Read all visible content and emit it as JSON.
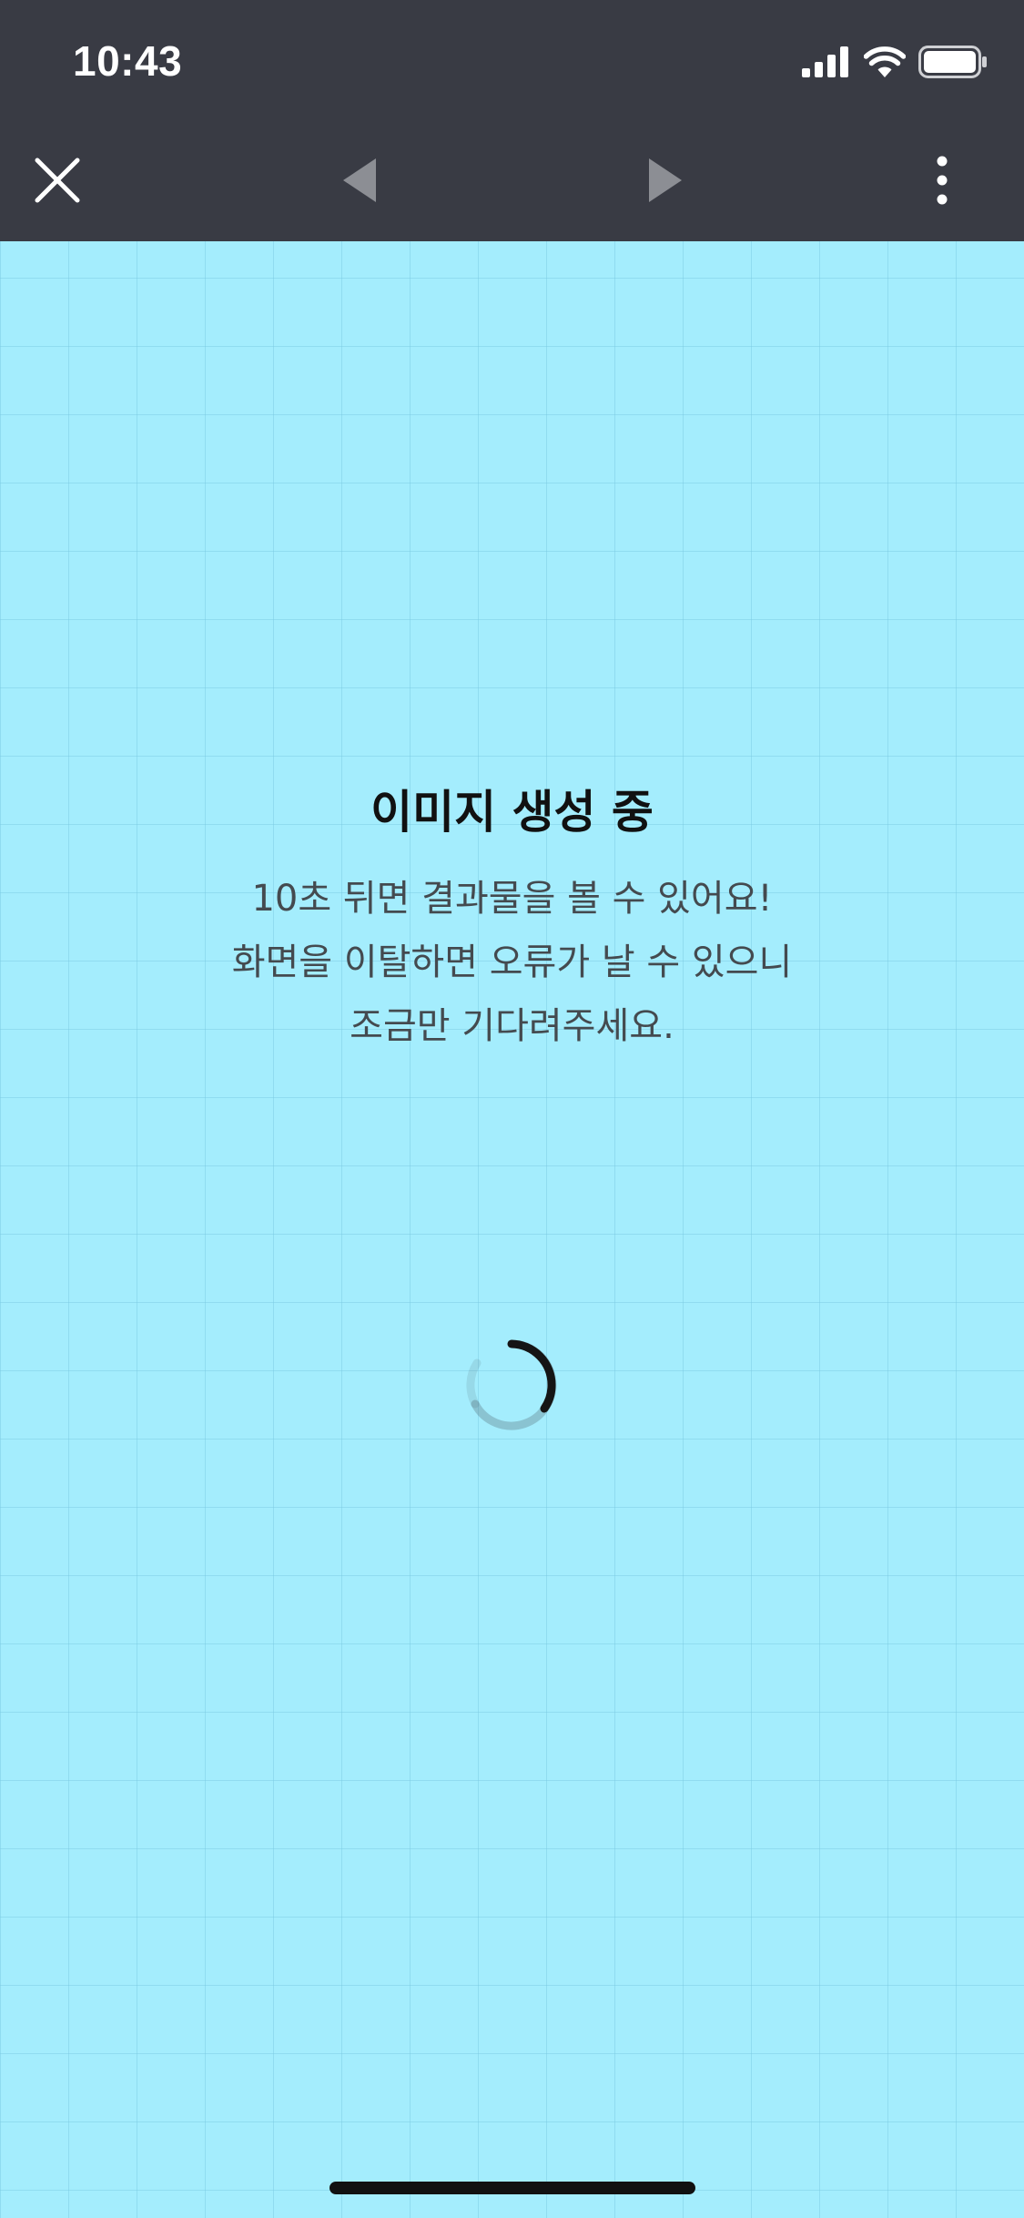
{
  "status_bar": {
    "time": "10:43",
    "icons": [
      "signal-icon",
      "wifi-icon",
      "battery-icon"
    ]
  },
  "toolbar": {
    "close_icon": "close-icon",
    "back_icon": "back-arrow-icon",
    "forward_icon": "forward-arrow-icon",
    "more_icon": "more-vertical-icon"
  },
  "loading": {
    "title": "이미지 생성 중",
    "lines": [
      "10초 뒤면 결과물을 볼 수 있어요!",
      "화면을 이탈하면 오류가 날 수 있으니",
      "조금만 기다려주세요."
    ],
    "spinner_icon": "loading-spinner-icon"
  },
  "colors": {
    "header_bg": "#393b44",
    "content_bg": "#a4edfd",
    "title_text": "#111111",
    "desc_text": "#444a4f"
  }
}
